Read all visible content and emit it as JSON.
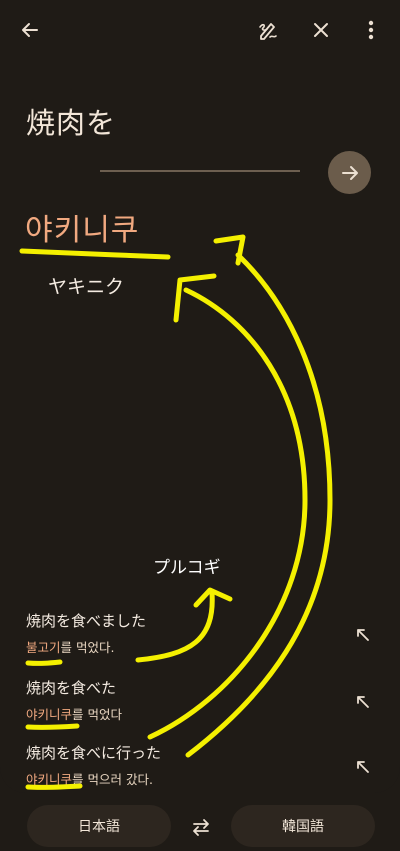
{
  "source": {
    "text": "焼肉を"
  },
  "result": {
    "translation": "야키니쿠",
    "romanization": "ヤキニク"
  },
  "annotation": {
    "word": "プルコギ"
  },
  "examples": [
    {
      "jp": "焼肉を食べました",
      "kr_hl": "불고기",
      "kr_rest": "를 먹었다."
    },
    {
      "jp": "焼肉を食べた",
      "kr_hl": "야키니쿠",
      "kr_rest": "를 먹었다"
    },
    {
      "jp": "焼肉を食べに行った",
      "kr_hl": "야키니쿠",
      "kr_rest": "를 먹으러 갔다."
    }
  ],
  "languages": {
    "source": "日本語",
    "target": "韓国語"
  },
  "colors": {
    "background": "#1f1b16",
    "accent": "#f1a980",
    "scribble": "#f4f000"
  },
  "icons": {
    "back": "arrow-left-icon",
    "draw": "handwriting-icon",
    "close": "close-icon",
    "more": "more-vert-icon",
    "go": "arrow-right-icon",
    "expand": "expand-icon",
    "swap": "swap-icon"
  }
}
